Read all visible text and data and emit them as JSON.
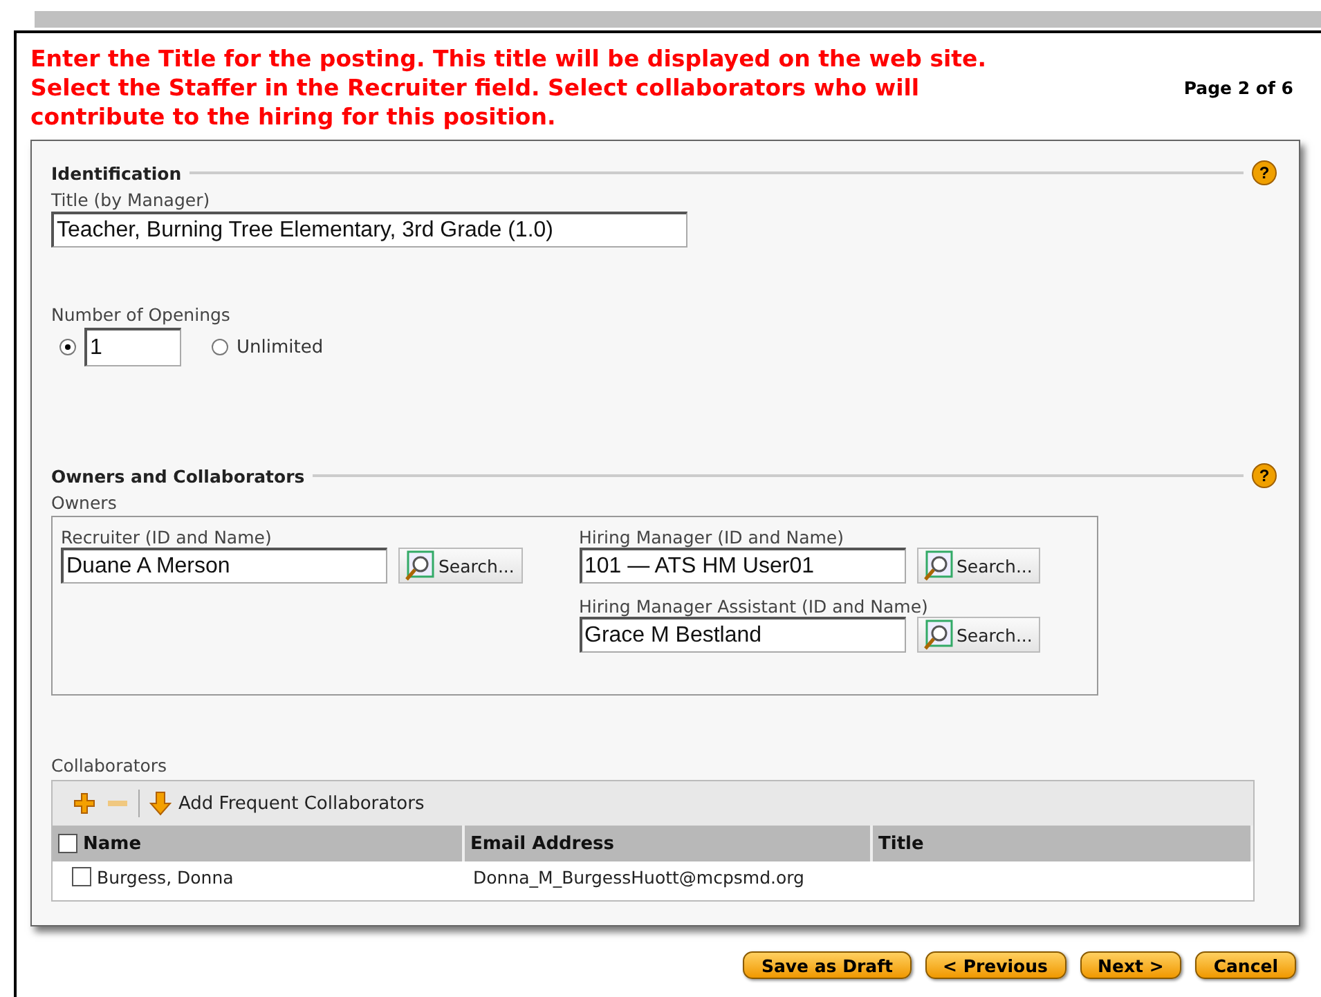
{
  "instructions": [
    "Enter the Title for the posting. This title will be displayed on the web site.",
    "Select the Staffer in the Recruiter field. Select collaborators who will",
    "contribute to the hiring for this position."
  ],
  "page_indicator": "Page 2 of 6",
  "identification": {
    "heading": "Identification",
    "help": "?",
    "title_label": "Title (by Manager)",
    "title_value": "Teacher, Burning Tree Elementary, 3rd Grade (1.0)",
    "openings_label": "Number of Openings",
    "openings": [
      {
        "kind": "count",
        "value": "1",
        "selected": true
      },
      {
        "kind": "unlimited",
        "label": "Unlimited",
        "selected": false
      }
    ]
  },
  "owners_section": {
    "heading": "Owners and Collaborators",
    "help": "?",
    "owners_label": "Owners",
    "owners_left": [
      {
        "label": "Recruiter (ID and Name)",
        "value": "Duane A Merson",
        "button": "Search..."
      }
    ],
    "owners_right": [
      {
        "label": "Hiring Manager (ID and Name)",
        "value": "101 — ATS HM User01",
        "button": "Search..."
      },
      {
        "label": "Hiring Manager Assistant (ID and Name)",
        "value": "Grace M Bestland",
        "button": "Search..."
      }
    ],
    "collaborators_label": "Collaborators",
    "toolbar_action": "Add Frequent Collaborators",
    "columns": [
      "Name",
      "Email Address",
      "Title"
    ],
    "header_checked": false,
    "rows": [
      {
        "name": "Burgess, Donna",
        "email": "Donna_M_BurgessHuott@mcpsmd.org",
        "checked": false
      }
    ]
  },
  "buttons": [
    "Save as Draft",
    "< Previous",
    "Next >",
    "Cancel"
  ]
}
